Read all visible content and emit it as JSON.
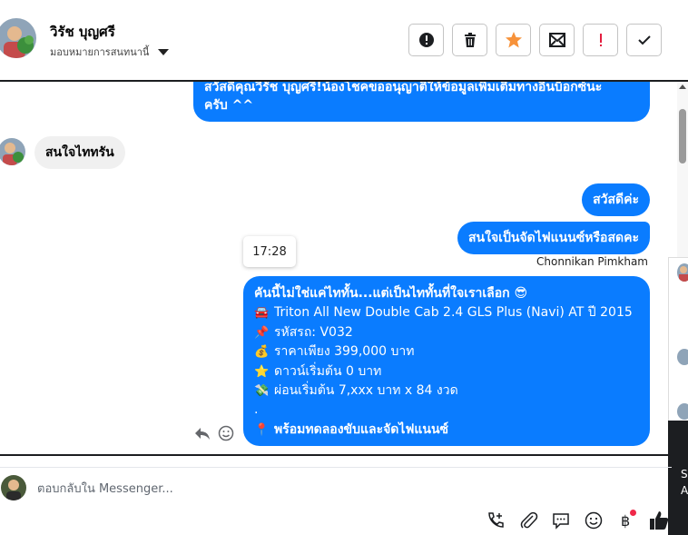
{
  "header": {
    "contact_name": "วิรัช บุญศรี",
    "assign_label": "มอบหมายการสนทนานี้",
    "toolbar": [
      {
        "name": "report-button",
        "icon": "exclamation-circle-icon"
      },
      {
        "name": "delete-button",
        "icon": "trash-icon"
      },
      {
        "name": "star-button",
        "icon": "star-icon"
      },
      {
        "name": "mark-unread-button",
        "icon": "mail-icon"
      },
      {
        "name": "important-button",
        "icon": "exclamation-icon"
      },
      {
        "name": "done-button",
        "icon": "check-icon"
      }
    ]
  },
  "messages": {
    "top_outgoing": [
      "สวัสดีคุณวิรัช บุญศรี!น้องโชคขออนุญาติให้ข้อมูลเพิ่มเติมทางอินบ็อกซ์นะ",
      "ครับ ^^"
    ],
    "incoming": "สนใจไททรัน",
    "hello": "สวัสดีค่ะ",
    "interest": "สนใจเป็นจัดไฟแนนซ์หรือสดคะ",
    "sender": "Chonnikan Pimkham",
    "timestamp": "17:28",
    "details": [
      {
        "emoji": "",
        "text": "คันนี้ไม่ใช่แค่ไททั้น...แต่เป็นไททั้นที่ใจเราเลือก 😎",
        "bold": true
      },
      {
        "emoji": "🚘",
        "text": "Triton All New Double Cab 2.4 GLS Plus (Navi) AT ปี 2015",
        "bold": false
      },
      {
        "emoji": "📌",
        "text": "รหัสรถ: V032",
        "bold": false
      },
      {
        "emoji": "💰",
        "text": "ราคาเพียง 399,000 บาท",
        "bold": false
      },
      {
        "emoji": "⭐",
        "text": "ดาวน์เริ่มต้น 0 บาท",
        "bold": false
      },
      {
        "emoji": "💸",
        "text": "ผ่อนเริ่มต้น 7,xxx บาท x 84 งวด",
        "bold": false
      },
      {
        "emoji": "",
        "text": ".",
        "bold": false
      },
      {
        "emoji": "📍",
        "text": "พร้อมทดลองขับและจัดไฟแนนซ์",
        "bold": true
      }
    ]
  },
  "side_panel": {
    "letters": [
      "S",
      "A"
    ]
  },
  "composer": {
    "placeholder": "ตอบกลับใน Messenger...",
    "tools": [
      "add-call-icon",
      "attachment-icon",
      "saved-reply-icon",
      "emoji-icon",
      "baht-icon",
      "like-icon"
    ]
  },
  "colors": {
    "messenger_blue": "#0a7cff",
    "incoming_bg": "#f0f0f0",
    "star": "#f7923a",
    "alert_red": "#e41e3f"
  }
}
